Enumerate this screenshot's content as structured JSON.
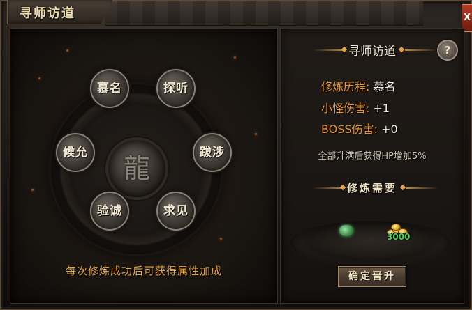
{
  "window": {
    "title": "寻师访道",
    "close_label": "X"
  },
  "wheel": {
    "nodes": [
      "慕名",
      "探听",
      "跋涉",
      "求见",
      "验诚",
      "候允"
    ],
    "note": "每次修炼成功后可获得属性加成"
  },
  "info": {
    "title": "寻师访道",
    "help_label": "?",
    "stats": [
      {
        "label": "修炼历程:",
        "value": "慕名"
      },
      {
        "label": "小怪伤害:",
        "value": "+1"
      },
      {
        "label": "BOSS伤害:",
        "value": "+0"
      }
    ],
    "bonus": "全部升满后获得HP增加5%",
    "requirement_title": "修炼需要",
    "requirements": [
      {
        "icon": "jade-stone-icon"
      },
      {
        "icon": "gold-coins-icon",
        "count": "3000"
      }
    ],
    "confirm_label": "确定晋升"
  }
}
